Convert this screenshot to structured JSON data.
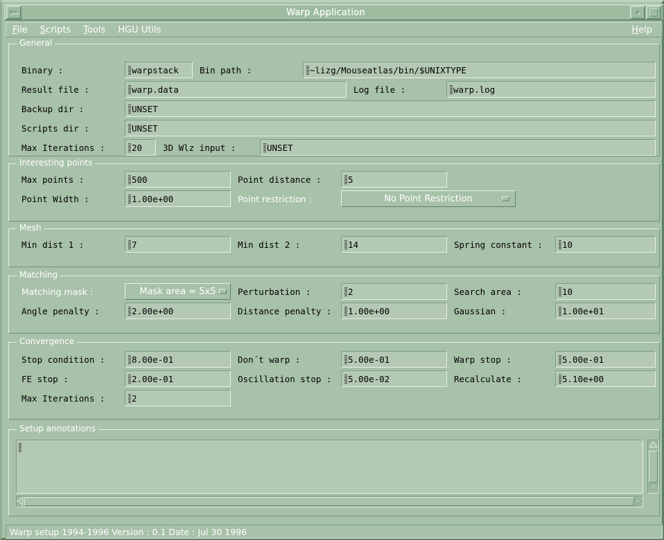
{
  "window": {
    "title": "Warp Application",
    "menu_button_icon": "window-menu-icon",
    "minimize_icon": "minimize-icon",
    "maximize_icon": "maximize-icon"
  },
  "menubar": {
    "items": [
      {
        "label": "File",
        "mnemonic": "F"
      },
      {
        "label": "Scripts",
        "mnemonic": "S"
      },
      {
        "label": "Tools",
        "mnemonic": "T"
      },
      {
        "label": "HGU Utils",
        "mnemonic": ""
      }
    ],
    "help": {
      "label": "Help",
      "mnemonic": "H"
    }
  },
  "groups": {
    "general": {
      "title": "General",
      "fields": {
        "binary_label": "Binary :",
        "binary_value": "warpstack",
        "bin_path_label": "Bin path :",
        "bin_path_value": "~lizg/Mouseatlas/bin/$UNIXTYPE",
        "result_file_label": "Result file :",
        "result_file_value": "warp.data",
        "log_file_label": "Log file :",
        "log_file_value": "warp.log",
        "backup_dir_label": "Backup dir :",
        "backup_dir_value": "UNSET",
        "scripts_dir_label": "Scripts dir :",
        "scripts_dir_value": "UNSET",
        "max_iterations_label": "Max Iterations :",
        "max_iterations_value": "20",
        "wlz_input_label": "3D Wlz input :",
        "wlz_input_value": "UNSET"
      }
    },
    "interesting_points": {
      "title": "Interesting points",
      "fields": {
        "max_points_label": "Max points :",
        "max_points_value": "500",
        "point_distance_label": "Point distance :",
        "point_distance_value": "5",
        "point_width_label": "Point Width :",
        "point_width_value": "1.00e+00",
        "point_restriction_label": "Point restriction  :",
        "point_restriction_value": "No Point Restriction"
      }
    },
    "mesh": {
      "title": "Mesh",
      "fields": {
        "min_dist1_label": "Min dist 1 :",
        "min_dist1_value": "7",
        "min_dist2_label": "Min dist 2 :",
        "min_dist2_value": "14",
        "spring_constant_label": "Spring constant :",
        "spring_constant_value": "10"
      }
    },
    "matching": {
      "title": "Matching",
      "fields": {
        "matching_mask_label": "Matching mask      :",
        "matching_mask_value": "Mask area = 5x5",
        "perturbation_label": "Perturbation :",
        "perturbation_value": "2",
        "search_area_label": "Search area :",
        "search_area_value": "10",
        "angle_penalty_label": "Angle penalty :",
        "angle_penalty_value": "2.00e+00",
        "distance_penalty_label": "Distance penalty :",
        "distance_penalty_value": "1.00e+00",
        "gaussian_label": "Gaussian :",
        "gaussian_value": "1.00e+01"
      }
    },
    "convergence": {
      "title": "Convergence",
      "fields": {
        "stop_condition_label": "Stop condition :",
        "stop_condition_value": "8.00e-01",
        "dont_warp_label": "Don´t warp :",
        "dont_warp_value": "5.00e-01",
        "warp_stop_label": "Warp stop :",
        "warp_stop_value": "5.00e-01",
        "fe_stop_label": "FE stop :",
        "fe_stop_value": "2.00e-01",
        "oscillation_stop_label": "Oscillation stop :",
        "oscillation_stop_value": "5.00e-02",
        "recalculate_label": "Recalculate :",
        "recalculate_value": "5.10e+00",
        "max_iterations_label": "Max Iterations :",
        "max_iterations_value": "2"
      }
    },
    "setup_annotations": {
      "title": "Setup annotations",
      "text_value": ""
    }
  },
  "statusbar": {
    "text": "Warp setup 1994-1996 Version : 0.1  Date : Jul 30 1996"
  },
  "colors": {
    "window_bg": "#a8c1a9",
    "field_bg": "#b4c9b4",
    "desktop": "#6f9476",
    "title_fg": "#ffffff",
    "text_fg": "#000000"
  }
}
